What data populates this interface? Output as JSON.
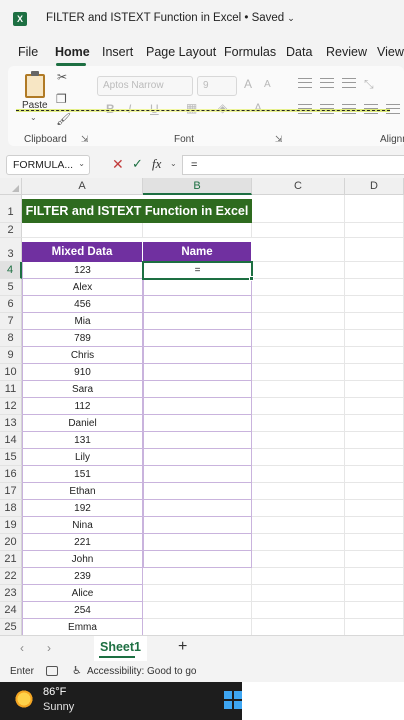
{
  "window": {
    "title": "FILTER and ISTEXT Function in Excel • Saved"
  },
  "ribbon_tabs": [
    "File",
    "Home",
    "Insert",
    "Page Layout",
    "Formulas",
    "Data",
    "Review",
    "View"
  ],
  "ribbon": {
    "paste_label": "Paste",
    "font_name": "Aptos Narrow",
    "font_size": "9",
    "groups": {
      "clipboard": "Clipboard",
      "font": "Font",
      "alignment": "Alignm"
    }
  },
  "formula_bar": {
    "name_box": "FORMULA...",
    "formula": "=",
    "fx_label": "fx"
  },
  "columns": [
    "A",
    "B",
    "C",
    "D"
  ],
  "rows": [
    "1",
    "2",
    "3",
    "4",
    "5",
    "6",
    "7",
    "8",
    "9",
    "10",
    "11",
    "12",
    "13",
    "14",
    "15",
    "16",
    "17",
    "18",
    "19",
    "20",
    "21",
    "22",
    "23",
    "24",
    "25"
  ],
  "sheet": {
    "title": "FILTER and ISTEXT Function in Excel",
    "headers": {
      "a": "Mixed Data",
      "b": "Name"
    },
    "mixed_data": [
      "123",
      "Alex",
      "456",
      "Mia",
      "789",
      "Chris",
      "910",
      "Sara",
      "112",
      "Daniel",
      "131",
      "Lily",
      "151",
      "Ethan",
      "192",
      "Nina",
      "221",
      "John",
      "239",
      "Alice",
      "254",
      "Emma"
    ],
    "active_cell_value": "="
  },
  "sheet_tabs": [
    "Sheet1"
  ],
  "status": {
    "mode": "Enter",
    "accessibility": "Accessibility: Good to go"
  },
  "taskbar": {
    "temperature": "86°F",
    "weather": "Sunny"
  },
  "colors": {
    "excel_green": "#1d6f42",
    "title_fill": "#2e6b1f",
    "header_fill": "#7030a0"
  },
  "icons": [
    "excel-logo-icon",
    "paste-icon",
    "cut-icon",
    "copy-icon",
    "format-painter-icon",
    "cancel-icon",
    "enter-icon",
    "function-icon",
    "add-sheet-icon",
    "sun-icon",
    "windows-start-icon"
  ]
}
